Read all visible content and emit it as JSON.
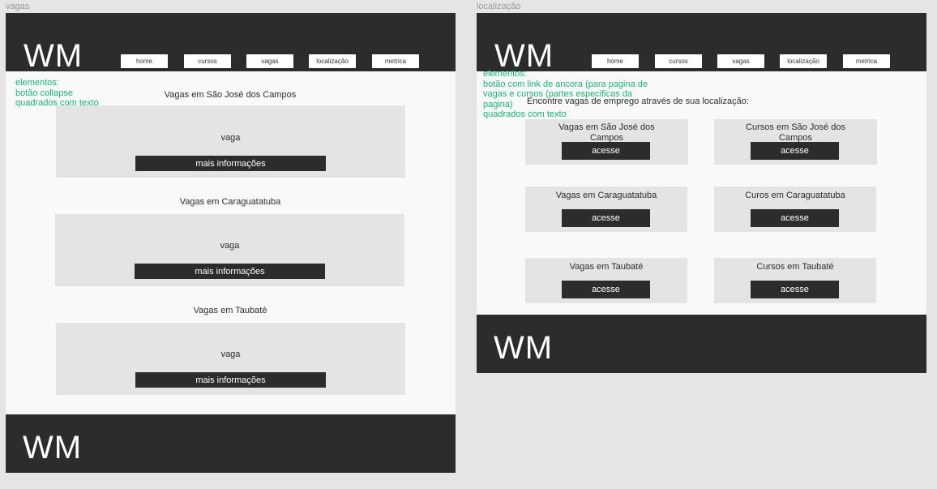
{
  "frames": {
    "vagas": {
      "label": "vagas",
      "logo": "WM",
      "footer_logo": "WM",
      "nav": [
        "home",
        "cursos",
        "vagas",
        "localização",
        "metrica"
      ],
      "annotation": [
        "elementos:",
        "botão collapse",
        "quadrados com texto"
      ],
      "sections": [
        {
          "title": "Vagas em São José dos Campos",
          "card_text": "vaga",
          "button": "mais informações"
        },
        {
          "title": "Vagas em Caraguatatuba",
          "card_text": "vaga",
          "button": "mais informações"
        },
        {
          "title": "Vagas em Taubaté",
          "card_text": "vaga",
          "button": "mais informações"
        }
      ]
    },
    "localizacao": {
      "label": "localização",
      "logo": "WM",
      "footer_logo": "WM",
      "nav": [
        "home",
        "cursos",
        "vagas",
        "localização",
        "metrica"
      ],
      "annotation": [
        "elementos:",
        "botão com link de ancora (para pagina de",
        "vagas e cursos (partes especificas da",
        "pagina)",
        "quadrados com texto"
      ],
      "intro": "Encontre vagas de emprego através de sua localização:",
      "cards": [
        {
          "title": "Vagas em São José dos Campos",
          "button": "acesse"
        },
        {
          "title": "Cursos em São José dos Campos",
          "button": "acesse"
        },
        {
          "title": "Vagas em Caraguatatuba",
          "button": "acesse"
        },
        {
          "title": "Curos em Caraguatatuba",
          "button": "acesse"
        },
        {
          "title": "Vagas em Taubaté",
          "button": "acesse"
        },
        {
          "title": "Cursos em Taubaté",
          "button": "acesse"
        }
      ]
    }
  },
  "colors": {
    "canvas": "#e5e5e5",
    "dark": "#2c2c2c",
    "frame_bg": "#f9f9f9",
    "card_bg": "#e4e4e4",
    "annotation": "#1bb071"
  }
}
